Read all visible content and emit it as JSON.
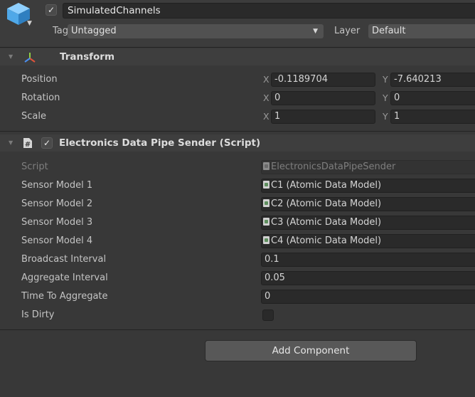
{
  "gameobject": {
    "active_check": "✓",
    "name": "SimulatedChannels",
    "tag_label": "Tag",
    "tag_value": "Untagged",
    "layer_label": "Layer",
    "layer_value": "Default"
  },
  "transform": {
    "title": "Transform",
    "position": {
      "label": "Position",
      "x_axis": "X",
      "x": "-0.1189704",
      "y_axis": "Y",
      "y": "-7.640213"
    },
    "rotation": {
      "label": "Rotation",
      "x_axis": "X",
      "x": "0",
      "y_axis": "Y",
      "y": "0"
    },
    "scale": {
      "label": "Scale",
      "x_axis": "X",
      "x": "1",
      "y_axis": "Y",
      "y": "1"
    }
  },
  "script_component": {
    "enabled_check": "✓",
    "title": "Electronics Data Pipe Sender (Script)",
    "script_label": "Script",
    "script_value": "ElectronicsDataPipeSender",
    "fields": [
      {
        "label": "Sensor Model 1",
        "value": "C1 (Atomic Data Model)"
      },
      {
        "label": "Sensor Model 2",
        "value": "C2 (Atomic Data Model)"
      },
      {
        "label": "Sensor Model 3",
        "value": "C3 (Atomic Data Model)"
      },
      {
        "label": "Sensor Model 4",
        "value": "C4 (Atomic Data Model)"
      },
      {
        "label": "Broadcast Interval",
        "value": "0.1"
      },
      {
        "label": "Aggregate Interval",
        "value": "0.05"
      },
      {
        "label": "Time To Aggregate",
        "value": "0"
      },
      {
        "label": "Is Dirty",
        "value": false
      }
    ]
  },
  "footer": {
    "add_component_label": "Add Component"
  },
  "icons": {
    "gameobject": "cube-icon",
    "transform": "transform-axes-icon",
    "script": "script-file-icon",
    "asset": "scriptable-object-icon"
  },
  "colors": {
    "background": "#383838",
    "field_background": "#2a2a2a",
    "button": "#585858",
    "cube_blue": "#4fa8e8",
    "axis_red": "#e0533a",
    "axis_green": "#8fcf44",
    "axis_blue": "#4b8ff0"
  }
}
